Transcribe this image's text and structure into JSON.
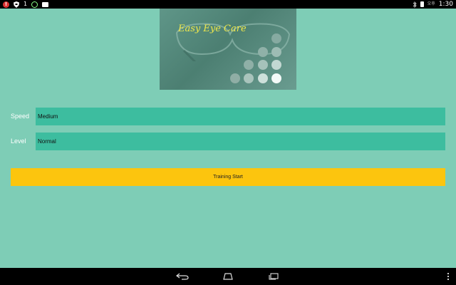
{
  "statusbar": {
    "notif_red_icon": "exclamation-icon",
    "notif_counter": "1",
    "clock_ampm": "오후",
    "clock_time": "1:30"
  },
  "banner": {
    "title": "Easy Eye Care"
  },
  "form": {
    "speed_label": "Speed",
    "speed_value": "Medium",
    "level_label": "Level",
    "level_value": "Normal",
    "start_label": "Training Start"
  },
  "colors": {
    "background": "#7ecdb6",
    "field": "#3dbd9f",
    "button": "#fcc50e",
    "title_text": "#f1e84a"
  }
}
